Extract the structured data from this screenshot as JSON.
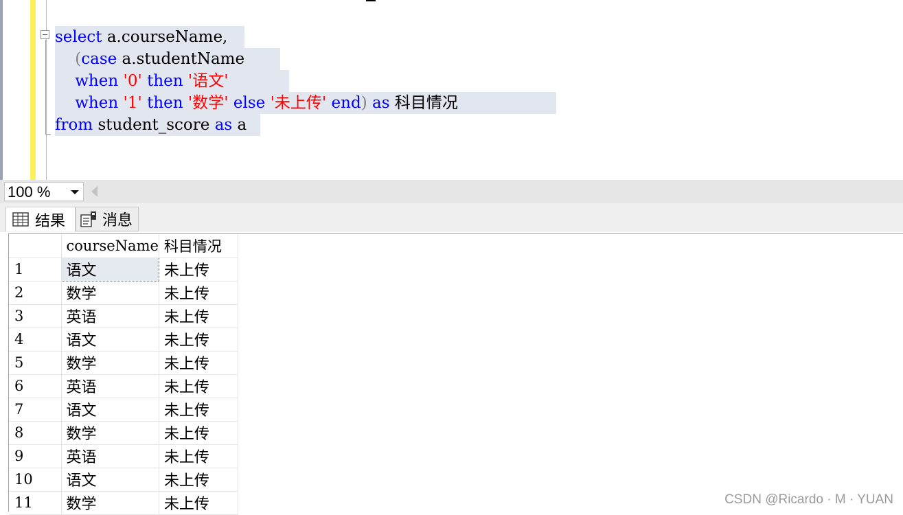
{
  "editor": {
    "lines": [
      {
        "kw1": "select",
        "t1": " a.courseName,"
      },
      {
        "p1": "(",
        "kw1": "case",
        "t1": " a.studentName"
      },
      {
        "kw1": "when",
        "s1": "'0'",
        "kw2": "then",
        "s2": "'语文'"
      },
      {
        "kw1": "when",
        "s1": "'1'",
        "kw2": "then",
        "s2": "'数学'",
        "kw3": "else",
        "s3": "'未上传'",
        "kw4": "end",
        "p1": ")",
        "kw5": "as",
        "t1": "科目情况"
      },
      {
        "kw1": "from",
        "t1": " student_score ",
        "kw2": "as",
        "t2": " a"
      }
    ]
  },
  "zoom": {
    "value": "100 %"
  },
  "tabs": {
    "results": "结果",
    "messages": "消息"
  },
  "grid": {
    "columns": [
      "",
      "courseName",
      "科目情况"
    ],
    "rows": [
      [
        "1",
        "语文",
        "未上传"
      ],
      [
        "2",
        "数学",
        "未上传"
      ],
      [
        "3",
        "英语",
        "未上传"
      ],
      [
        "4",
        "语文",
        "未上传"
      ],
      [
        "5",
        "数学",
        "未上传"
      ],
      [
        "6",
        "英语",
        "未上传"
      ],
      [
        "7",
        "语文",
        "未上传"
      ],
      [
        "8",
        "数学",
        "未上传"
      ],
      [
        "9",
        "英语",
        "未上传"
      ],
      [
        "10",
        "语文",
        "未上传"
      ],
      [
        "11",
        "数学",
        "未上传"
      ]
    ]
  },
  "watermark": "CSDN @Ricardo · M · YUAN",
  "colors": {
    "keyword": "#0000ff",
    "string": "#ff0000",
    "selection": "#e2e6ef",
    "change_bar": "#fbef5a"
  }
}
